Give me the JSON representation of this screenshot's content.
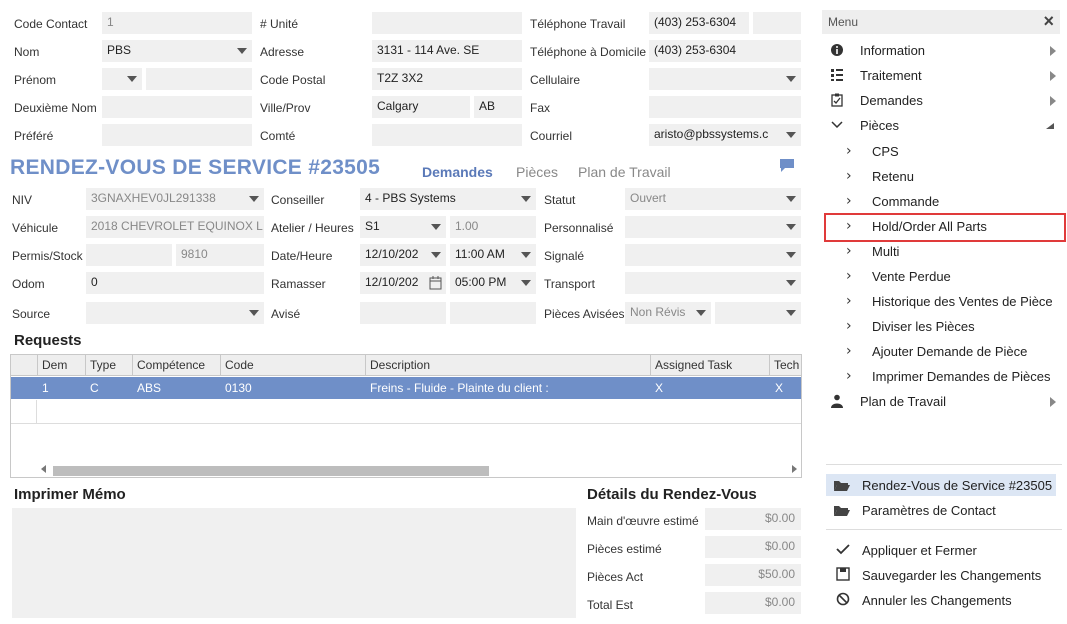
{
  "contact": {
    "code_contact_label": "Code Contact",
    "code_contact_value": "1",
    "nom_label": "Nom",
    "nom_value": "PBS",
    "prenom_label": "Prénom",
    "deuxieme_nom_label": "Deuxième Nom",
    "prefere_label": "Préféré",
    "unite_label": "# Unité",
    "adresse_label": "Adresse",
    "adresse_value": "3131 - 114 Ave. SE",
    "code_postal_label": "Code Postal",
    "code_postal_value": "T2Z 3X2",
    "ville_prov_label": "Ville/Prov",
    "ville_value": "Calgary",
    "prov_value": "AB",
    "comte_label": "Comté",
    "tel_travail_label": "Téléphone Travail",
    "tel_travail_value": "(403) 253-6304",
    "tel_domicile_label": "Téléphone à Domicile",
    "tel_domicile_value": "(403) 253-6304",
    "cellulaire_label": "Cellulaire",
    "fax_label": "Fax",
    "courriel_label": "Courriel",
    "courriel_value": "aristo@pbssystems.c"
  },
  "title": "RENDEZ-VOUS DE SERVICE #23505",
  "tabs": [
    "Demandes",
    "Pièces",
    "Plan de Travail"
  ],
  "vehicle": {
    "niv_label": "NIV",
    "niv_value": "3GNAXHEV0JL291338",
    "vehicule_label": "Véhicule",
    "vehicule_value": "2018 CHEVROLET EQUINOX L",
    "permis_label": "Permis/Stock",
    "stock_value": "9810",
    "odom_label": "Odom",
    "odom_value": "0",
    "source_label": "Source",
    "conseiller_label": "Conseiller",
    "conseiller_value": "4 - PBS Systems",
    "atelier_label": "Atelier / Heures",
    "atelier_value": "S1",
    "heures_value": "1.00",
    "date_heure_label": "Date/Heure",
    "date_value": "12/10/202",
    "heure_value": "11:00 AM",
    "ramasser_label": "Ramasser",
    "ramasser_date": "12/10/202",
    "ramasser_heure": "05:00 PM",
    "avise_label": "Avisé",
    "statut_label": "Statut",
    "statut_value": "Ouvert",
    "personnalise_label": "Personnalisé",
    "signale_label": "Signalé",
    "transport_label": "Transport",
    "pieces_avisees_label": "Pièces Avisées",
    "pieces_avisees_value": "Non Révis"
  },
  "requests": {
    "heading": "Requests",
    "columns": [
      "Dem",
      "Type",
      "Compétence",
      "Code",
      "Description",
      "Assigned Task",
      "Tech"
    ],
    "rows": [
      [
        "1",
        "C",
        "ABS",
        "0130",
        "Freins - Fluide - Plainte du client :",
        "X",
        "X"
      ]
    ]
  },
  "memo_heading": "Imprimer Mémo",
  "details": {
    "heading": "Détails du Rendez-Vous",
    "main_oeuvre_label": "Main d'œuvre estimé",
    "main_oeuvre_value": "$0.00",
    "pieces_estime_label": "Pièces estimé",
    "pieces_estime_value": "$0.00",
    "pieces_act_label": "Pièces Act",
    "pieces_act_value": "$50.00",
    "total_label": "Total Est",
    "total_value": "$0.00"
  },
  "menu": {
    "header": "Menu",
    "items": [
      {
        "label": "Information",
        "icon": "info-icon"
      },
      {
        "label": "Traitement",
        "icon": "process-icon"
      },
      {
        "label": "Demandes",
        "icon": "clipboard-icon"
      },
      {
        "label": "Pièces",
        "icon": "chevron-down-icon"
      }
    ],
    "sub_items": [
      "CPS",
      "Retenu",
      "Commande",
      "Hold/Order All Parts",
      "Multi",
      "Vente Perdue",
      "Historique des Ventes de Pièce",
      "Diviser les Pièces",
      "Ajouter Demande de Pièce",
      "Imprimer Demandes de Pièces"
    ],
    "plan_label": "Plan de Travail",
    "folders": [
      "Rendez-Vous de Service #23505",
      "Paramètres de Contact"
    ],
    "actions": [
      "Appliquer et Fermer",
      "Sauvegarder les Changements",
      "Annuler les Changements"
    ]
  },
  "colors": {
    "accent": "#6f8fc8",
    "highlight_border": "#e03a3a"
  }
}
